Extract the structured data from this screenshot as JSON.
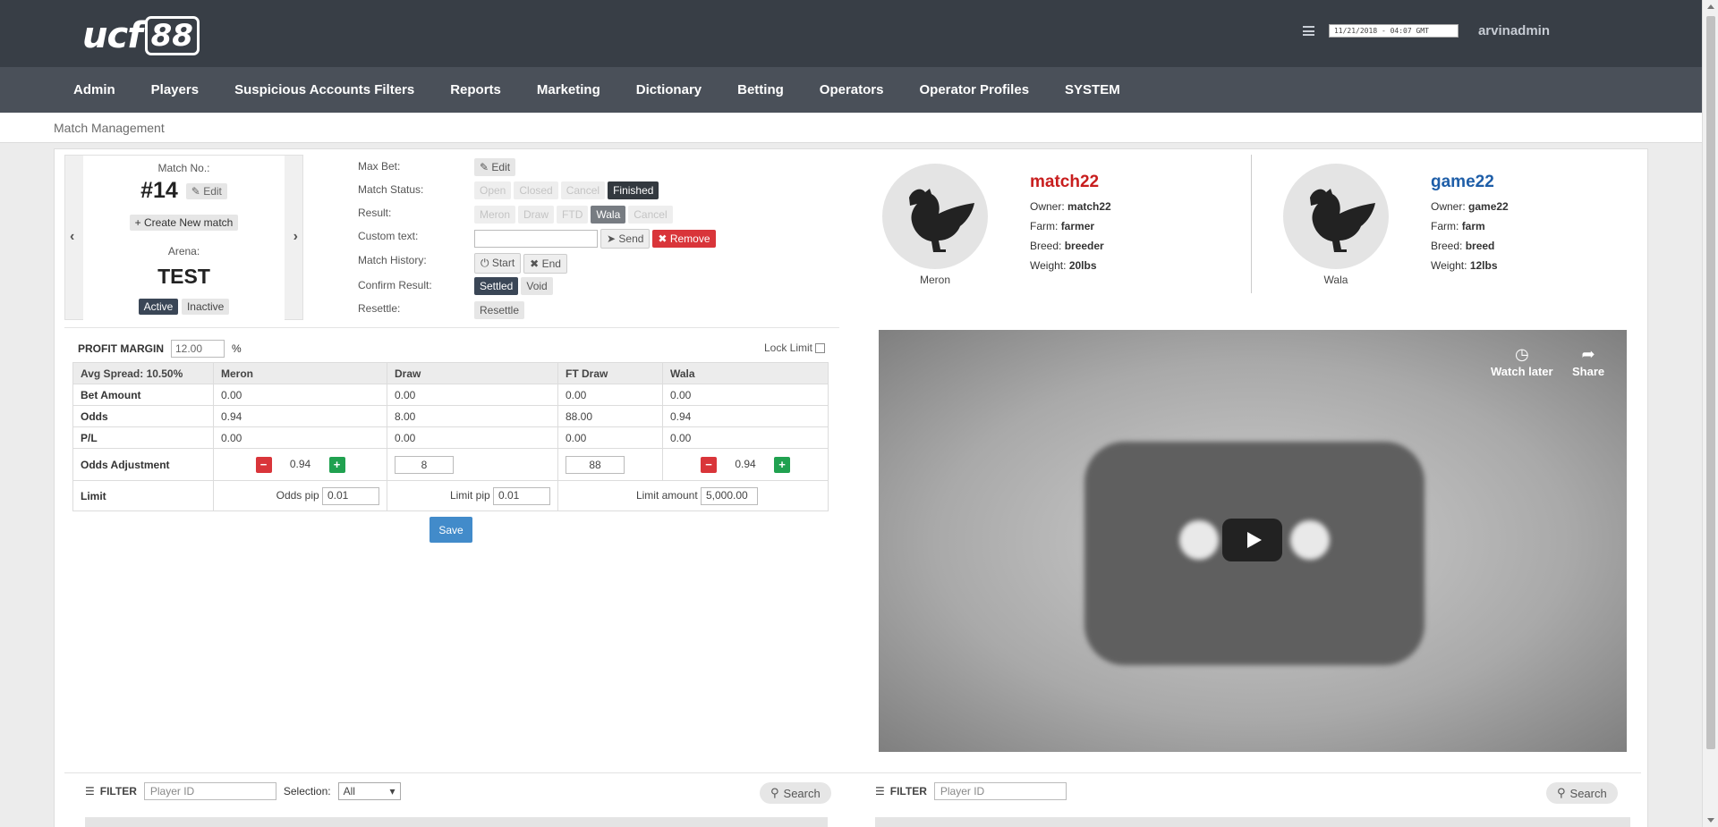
{
  "header": {
    "logo_text": "ucf",
    "logo_badge": "88",
    "datetime": "11/21/2018 - 04:07 GMT",
    "username": "arvinadmin"
  },
  "nav": [
    "Admin",
    "Players",
    "Suspicious Accounts Filters",
    "Reports",
    "Marketing",
    "Dictionary",
    "Betting",
    "Operators",
    "Operator Profiles",
    "SYSTEM"
  ],
  "breadcrumb": "Match Management",
  "match": {
    "match_no_label": "Match No.:",
    "number": "#14",
    "edit_label": "Edit",
    "create_label": "Create New match",
    "arena_label": "Arena:",
    "arena": "TEST",
    "active_label": "Active",
    "inactive_label": "Inactive"
  },
  "controls": {
    "max_bet_label": "Max Bet:",
    "max_bet_edit": "Edit",
    "match_status_label": "Match Status:",
    "statuses": [
      "Open",
      "Closed",
      "Cancel",
      "Finished"
    ],
    "result_label": "Result:",
    "results": [
      "Meron",
      "Draw",
      "FTD",
      "Wala",
      "Cancel"
    ],
    "custom_text_label": "Custom text:",
    "send_label": "Send",
    "remove_label": "Remove",
    "history_label": "Match History:",
    "start_label": "Start",
    "end_label": "End",
    "confirm_label": "Confirm Result:",
    "settled_label": "Settled",
    "void_label": "Void",
    "resettle_label": "Resettle:",
    "resettle_btn": "Resettle"
  },
  "fighters": {
    "meron": {
      "name": "match22",
      "owner_label": "Owner:",
      "owner": "match22",
      "farm_label": "Farm:",
      "farm": "farmer",
      "breed_label": "Breed:",
      "breed": "breeder",
      "weight_label": "Weight:",
      "weight": "20lbs",
      "side": "Meron",
      "color": "#c81e1e"
    },
    "wala": {
      "name": "game22",
      "owner_label": "Owner:",
      "owner": "game22",
      "farm_label": "Farm:",
      "farm": "farm",
      "breed_label": "Breed:",
      "breed": "breed",
      "weight_label": "Weight:",
      "weight": "12lbs",
      "side": "Wala",
      "color": "#1e5ea8"
    }
  },
  "odds": {
    "profit_margin_label": "PROFIT MARGIN",
    "profit_margin": "12.00",
    "percent": "%",
    "lock_limit_label": "Lock Limit",
    "headers": [
      "Avg Spread: 10.50%",
      "Meron",
      "Draw",
      "FT Draw",
      "Wala"
    ],
    "rows": [
      {
        "label": "Bet Amount",
        "values": [
          "0.00",
          "0.00",
          "0.00",
          "0.00"
        ]
      },
      {
        "label": "Odds",
        "values": [
          "0.94",
          "8.00",
          "88.00",
          "0.94"
        ]
      },
      {
        "label": "P/L",
        "values": [
          "0.00",
          "0.00",
          "0.00",
          "0.00"
        ]
      }
    ],
    "adjust_label": "Odds Adjustment",
    "adjust_values": [
      "0.94",
      "8",
      "88",
      "0.94"
    ],
    "limit_label": "Limit",
    "odds_pip_label": "Odds pip",
    "odds_pip": "0.01",
    "limit_pip_label": "Limit pip",
    "limit_pip": "0.01",
    "limit_amount_label": "Limit amount",
    "limit_amount": "5,000.00",
    "save_label": "Save"
  },
  "video": {
    "watch_later": "Watch later",
    "share": "Share"
  },
  "filters": {
    "left": {
      "label": "FILTER",
      "placeholder": "Player ID",
      "selection_label": "Selection:",
      "selection": "All",
      "search": "Search"
    },
    "right": {
      "label": "FILTER",
      "placeholder": "Player ID",
      "search": "Search"
    }
  }
}
